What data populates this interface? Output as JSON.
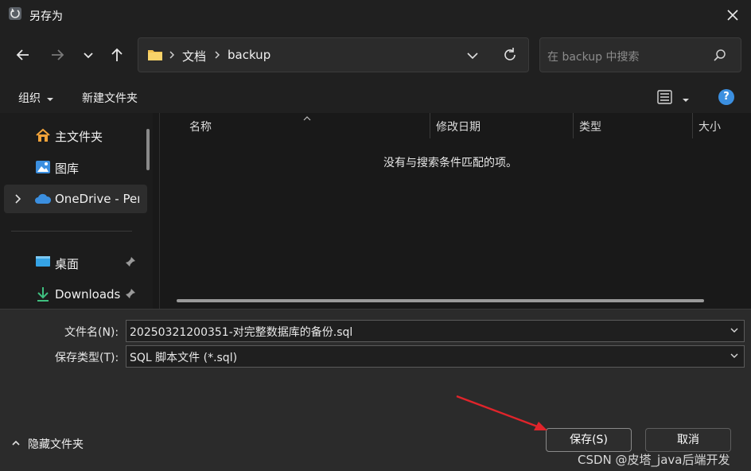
{
  "window": {
    "title": "另存为",
    "close_icon": "close-icon"
  },
  "nav": {
    "back_icon": "arrow-left-icon",
    "forward_icon": "arrow-right-icon",
    "recent_icon": "chevron-down-icon",
    "up_icon": "arrow-up-icon",
    "breadcrumb": [
      "文档",
      "backup"
    ],
    "refresh_icon": "refresh-icon",
    "search_placeholder": "在 backup 中搜索"
  },
  "toolbar": {
    "organize": "组织",
    "new_folder": "新建文件夹",
    "help": "?"
  },
  "sidebar": {
    "items": [
      {
        "label": "主文件夹",
        "icon": "home-icon"
      },
      {
        "label": "图库",
        "icon": "gallery-icon"
      },
      {
        "label": "OneDrive - Per",
        "icon": "cloud-icon"
      },
      {
        "label": "桌面",
        "icon": "desktop-icon",
        "pinned": true
      },
      {
        "label": "Downloads",
        "icon": "download-icon",
        "pinned": true
      }
    ]
  },
  "file_list": {
    "columns": [
      "名称",
      "修改日期",
      "类型",
      "大小"
    ],
    "empty_message": "没有与搜索条件匹配的项。"
  },
  "form": {
    "filename_label": "文件名(N):",
    "filename_value": "20250321200351-对完整数据库的备份.sql",
    "filetype_label": "保存类型(T):",
    "filetype_value": "SQL 脚本文件 (*.sql)"
  },
  "footer": {
    "hide_folders": "隐藏文件夹",
    "save": "保存(S)",
    "cancel": "取消",
    "watermark": "CSDN @皮塔_java后端开发"
  },
  "colors": {
    "accent": "#3b8fe0",
    "arrow": "#e0242b",
    "folder": "#f2c14e"
  }
}
